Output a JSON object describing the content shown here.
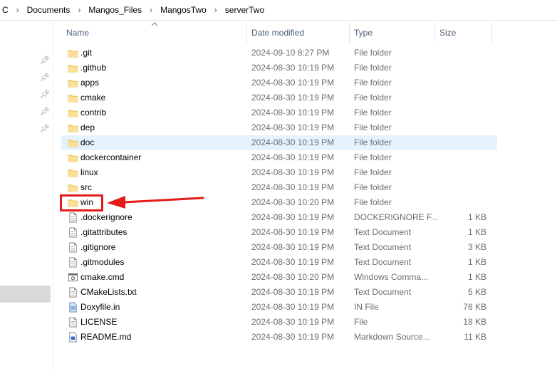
{
  "breadcrumb": {
    "items": [
      "C",
      "Documents",
      "Mangos_Files",
      "MangosTwo",
      "serverTwo"
    ],
    "separator": "›"
  },
  "columns": {
    "name": "Name",
    "date": "Date modified",
    "type": "Type",
    "size": "Size"
  },
  "icons": {
    "folder": "folder-icon",
    "text_file": "text-file-icon",
    "cmd_file": "cmd-file-icon",
    "ini_file": "ini-file-icon",
    "markdown_file": "markdown-file-icon",
    "pin": "pin-icon"
  },
  "colors": {
    "folder": "#f8d775",
    "selected_row": "#e5f3ff",
    "annotation": "#e41b1b",
    "header_text": "#4c607a",
    "detail_text": "#6d6d6d"
  },
  "files": [
    {
      "name": ".git",
      "date": "2024-09-10 8:27 PM",
      "type": "File folder",
      "size": "",
      "icon": "folder"
    },
    {
      "name": ".github",
      "date": "2024-08-30 10:19 PM",
      "type": "File folder",
      "size": "",
      "icon": "folder"
    },
    {
      "name": "apps",
      "date": "2024-08-30 10:19 PM",
      "type": "File folder",
      "size": "",
      "icon": "folder"
    },
    {
      "name": "cmake",
      "date": "2024-08-30 10:19 PM",
      "type": "File folder",
      "size": "",
      "icon": "folder"
    },
    {
      "name": "contrib",
      "date": "2024-08-30 10:19 PM",
      "type": "File folder",
      "size": "",
      "icon": "folder"
    },
    {
      "name": "dep",
      "date": "2024-08-30 10:19 PM",
      "type": "File folder",
      "size": "",
      "icon": "folder"
    },
    {
      "name": "doc",
      "date": "2024-08-30 10:19 PM",
      "type": "File folder",
      "size": "",
      "icon": "folder",
      "selected": true
    },
    {
      "name": "dockercontainer",
      "date": "2024-08-30 10:19 PM",
      "type": "File folder",
      "size": "",
      "icon": "folder"
    },
    {
      "name": "linux",
      "date": "2024-08-30 10:19 PM",
      "type": "File folder",
      "size": "",
      "icon": "folder"
    },
    {
      "name": "src",
      "date": "2024-08-30 10:19 PM",
      "type": "File folder",
      "size": "",
      "icon": "folder"
    },
    {
      "name": "win",
      "date": "2024-08-30 10:20 PM",
      "type": "File folder",
      "size": "",
      "icon": "folder",
      "highlighted": true
    },
    {
      "name": ".dockerignore",
      "date": "2024-08-30 10:19 PM",
      "type": "DOCKERIGNORE F...",
      "size": "1 KB",
      "icon": "text_file"
    },
    {
      "name": ".gitattributes",
      "date": "2024-08-30 10:19 PM",
      "type": "Text Document",
      "size": "1 KB",
      "icon": "text_file"
    },
    {
      "name": ".gitignore",
      "date": "2024-08-30 10:19 PM",
      "type": "Text Document",
      "size": "3 KB",
      "icon": "text_file"
    },
    {
      "name": ".gitmodules",
      "date": "2024-08-30 10:19 PM",
      "type": "Text Document",
      "size": "1 KB",
      "icon": "text_file"
    },
    {
      "name": "cmake.cmd",
      "date": "2024-08-30 10:20 PM",
      "type": "Windows Comma...",
      "size": "1 KB",
      "icon": "cmd_file"
    },
    {
      "name": "CMakeLists.txt",
      "date": "2024-08-30 10:19 PM",
      "type": "Text Document",
      "size": "5 KB",
      "icon": "text_file"
    },
    {
      "name": "Doxyfile.in",
      "date": "2024-08-30 10:19 PM",
      "type": "IN File",
      "size": "76 KB",
      "icon": "ini_file"
    },
    {
      "name": "LICENSE",
      "date": "2024-08-30 10:19 PM",
      "type": "File",
      "size": "18 KB",
      "icon": "text_file"
    },
    {
      "name": "README.md",
      "date": "2024-08-30 10:19 PM",
      "type": "Markdown Source...",
      "size": "11 KB",
      "icon": "markdown_file"
    }
  ]
}
